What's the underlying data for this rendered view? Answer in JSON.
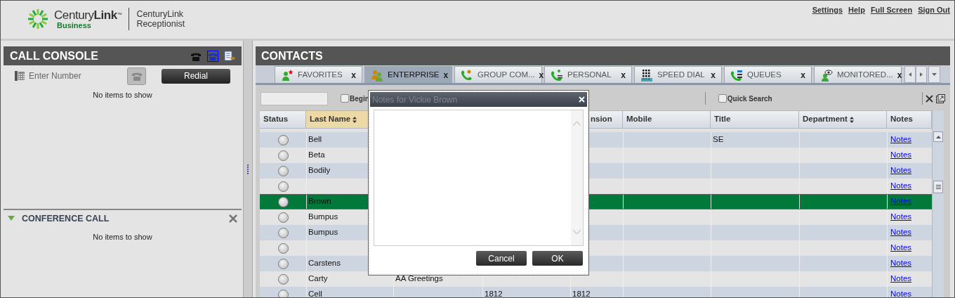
{
  "header": {
    "logo": {
      "brand_light": "Century",
      "brand_bold": "Link",
      "trademark": "™",
      "tagline": "Business"
    },
    "product": [
      "CenturyLink",
      "Receptionist"
    ],
    "links": [
      "Settings",
      "Help",
      "Full Screen",
      "Sign Out"
    ]
  },
  "call_console": {
    "title": "CALL CONSOLE",
    "number_field": {
      "placeholder": "Enter Number"
    },
    "redial_button": "Redial",
    "empty_text": "No items to show"
  },
  "conference_call": {
    "title": "CONFERENCE CALL",
    "expanded": true,
    "empty_text": "No items to show"
  },
  "contacts": {
    "title": "CONTACTS",
    "tabs": [
      {
        "label": "FAVORITES",
        "kind": "favorites",
        "selected": false,
        "close": "x"
      },
      {
        "label": "ENTERPRISE",
        "kind": "enterprise",
        "selected": true,
        "close": "x"
      },
      {
        "label": "GROUP COM...",
        "kind": "group",
        "selected": false,
        "close": "x"
      },
      {
        "label": "PERSONAL",
        "kind": "personal",
        "selected": false,
        "close": "x"
      },
      {
        "label": "SPEED DIAL",
        "kind": "speed_dial",
        "selected": false,
        "close": "x"
      },
      {
        "label": "QUEUES",
        "kind": "queues",
        "selected": false,
        "close": "x"
      },
      {
        "label": "MONITORED...",
        "kind": "monitored",
        "selected": false,
        "close": "x"
      }
    ],
    "toolbar": {
      "begin_with": {
        "label": "Begin",
        "checked": false
      },
      "quick_search": {
        "label": "Quick Search",
        "checked": false
      }
    },
    "table": {
      "columns": [
        {
          "label": "Status",
          "sortable": false,
          "sorted": false
        },
        {
          "label": "Last Name",
          "sortable": true,
          "sorted": true
        },
        {
          "label": "nsion",
          "sortable": false,
          "sorted": false
        },
        {
          "label": "Mobile",
          "sortable": false,
          "sorted": false
        },
        {
          "label": "Title",
          "sortable": false,
          "sorted": false
        },
        {
          "label": "Department",
          "sortable": true,
          "sorted": false
        },
        {
          "label": "Notes",
          "sortable": false,
          "sorted": false
        }
      ],
      "rows": [
        {
          "last_name": "Bell",
          "title": "SE",
          "notes": "Notes",
          "selected": false
        },
        {
          "last_name": "Beta",
          "notes": "Notes",
          "selected": false
        },
        {
          "last_name": "Bodily",
          "notes": "Notes",
          "selected": false
        },
        {
          "notes": "Notes",
          "selected": false
        },
        {
          "last_name": "Brown",
          "notes": "Notes",
          "selected": true
        },
        {
          "last_name": "Bumpus",
          "notes": "Notes",
          "selected": false
        },
        {
          "last_name": "Bumpus",
          "notes": "Notes",
          "selected": false
        },
        {
          "notes": "Notes",
          "selected": false
        },
        {
          "last_name": "Carstens",
          "notes": "Notes",
          "selected": false
        },
        {
          "last_name": "Carty",
          "first_name": "AA Greetings",
          "notes": "Notes",
          "selected": false
        },
        {
          "last_name": "Cell",
          "phone": "1812",
          "extension": "1812",
          "notes": "Notes",
          "selected": false
        }
      ]
    }
  },
  "dialog": {
    "title": "Notes for Vickie Brown",
    "buttons": [
      "Cancel",
      "OK"
    ]
  }
}
